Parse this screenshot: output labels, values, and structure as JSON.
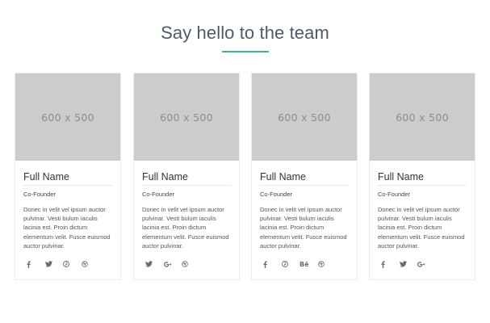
{
  "section": {
    "title": "Say hello to the team"
  },
  "members": [
    {
      "image_text": "600 x 500",
      "name": "Full Name",
      "role": "Co-Founder",
      "bio": "Donec in velit vel ipsum auctor pulvinar. Vesti bulum iaculis lacinia est. Proin dictum elementum velit. Fusce euismod auctor pulvinar.",
      "social": [
        "facebook-icon",
        "twitter-icon",
        "pinterest-icon",
        "dribbble-icon"
      ]
    },
    {
      "image_text": "600 x 500",
      "name": "Full Name",
      "role": "Co-Founder",
      "bio": "Donec in velit vel ipsum auctor pulvinar. Vesti bulum iaculis lacinia est. Proin dictum elementum velit. Fusce euismod auctor pulvinar.",
      "social": [
        "twitter-icon",
        "google-plus-icon",
        "dribbble-icon"
      ]
    },
    {
      "image_text": "600 x 500",
      "name": "Full Name",
      "role": "Co-Founder",
      "bio": "Donec in velit vel ipsum auctor pulvinar. Vesti bulum iaculis lacinia est. Proin dictum elementum velit. Fusce euismod auctor pulvinar.",
      "social": [
        "facebook-icon",
        "pinterest-icon",
        "behance-icon",
        "dribbble-icon"
      ],
      "behance_label": "Bē"
    },
    {
      "image_text": "600 x 500",
      "name": "Full Name",
      "role": "Co-Founder",
      "bio": "Donec in velit vel ipsum auctor pulvinar. Vesti bulum iaculis lacinia est. Proin dictum elementum velit. Fusce euismod auctor pulvinar.",
      "social": [
        "facebook-icon",
        "twitter-icon",
        "google-plus-icon"
      ]
    }
  ],
  "colors": {
    "accent": "#3fb7a6",
    "placeholder": "#cccccc",
    "title": "#4c5a6a"
  }
}
